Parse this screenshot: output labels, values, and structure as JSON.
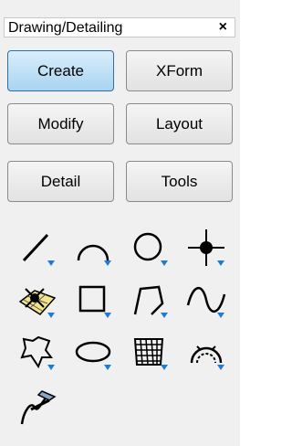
{
  "panel": {
    "title": "Drawing/Detailing",
    "close_label": "×"
  },
  "buttons": [
    {
      "label": "Create",
      "active": true
    },
    {
      "label": "XForm",
      "active": false
    },
    {
      "label": "Modify",
      "active": false
    },
    {
      "label": "Layout",
      "active": false
    },
    {
      "label": "Detail",
      "active": false
    },
    {
      "label": "Tools",
      "active": false
    }
  ],
  "tools": [
    {
      "icon": "line-icon"
    },
    {
      "icon": "arc-icon"
    },
    {
      "icon": "circle-icon"
    },
    {
      "icon": "point-icon"
    },
    {
      "icon": "surface-point-icon"
    },
    {
      "icon": "rectangle-icon"
    },
    {
      "icon": "polyline-icon"
    },
    {
      "icon": "spline-icon"
    },
    {
      "icon": "freeform-curve-icon"
    },
    {
      "icon": "ellipse-icon"
    },
    {
      "icon": "mesh-icon"
    },
    {
      "icon": "offset-arc-icon"
    },
    {
      "icon": "sketch-pen-icon"
    }
  ],
  "colors": {
    "accent": "#2f6f9c",
    "tool_arrow": "#1e7bd6"
  }
}
